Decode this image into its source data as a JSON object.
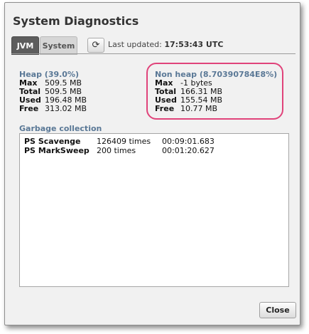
{
  "dialog": {
    "title": "System Diagnostics",
    "tabs": [
      {
        "label": "JVM",
        "active": true
      },
      {
        "label": "System",
        "active": false
      }
    ],
    "refresh_icon": "refresh-icon",
    "last_updated_label": "Last updated:",
    "last_updated_value": "17:53:43 UTC"
  },
  "heap": {
    "heading": "Heap (39.0%)",
    "rows": [
      {
        "key": "Max",
        "value": "509.5 MB"
      },
      {
        "key": "Total",
        "value": "509.5 MB"
      },
      {
        "key": "Used",
        "value": "196.48 MB"
      },
      {
        "key": "Free",
        "value": "313.02 MB"
      }
    ]
  },
  "non_heap": {
    "heading": "Non heap (8.70390784E8%)",
    "rows": [
      {
        "key": "Max",
        "value": "-1 bytes"
      },
      {
        "key": "Total",
        "value": "166.31 MB"
      },
      {
        "key": "Used",
        "value": "155.54 MB"
      },
      {
        "key": "Free",
        "value": "10.77 MB"
      }
    ],
    "highlight_color": "#e0437a"
  },
  "gc": {
    "heading": "Garbage collection",
    "rows": [
      {
        "name": "PS Scavenge",
        "count": "126409 times",
        "time": "00:09:01.683"
      },
      {
        "name": "PS MarkSweep",
        "count": "200 times",
        "time": "00:01:20.627"
      }
    ]
  },
  "footer": {
    "close_label": "Close"
  }
}
